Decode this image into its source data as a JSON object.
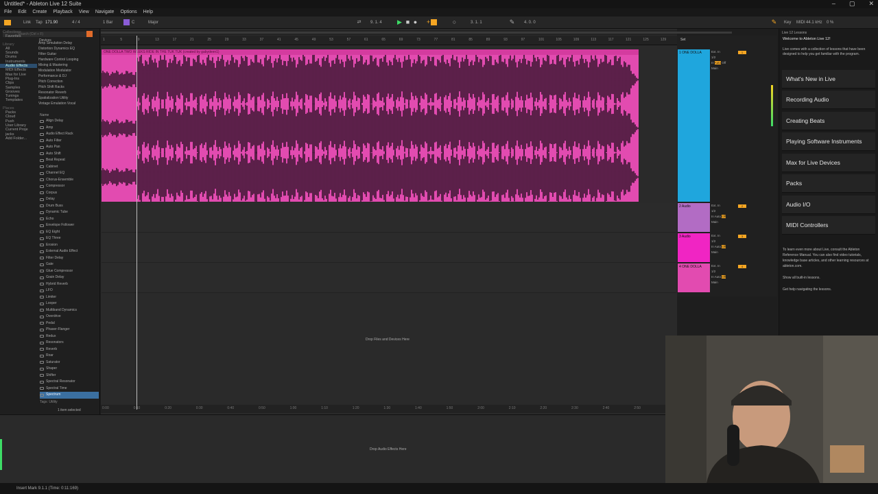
{
  "window": {
    "title": "Untitled* - Ableton Live 12 Suite",
    "controls": [
      "–",
      "▢",
      "✕"
    ]
  },
  "menu": [
    "File",
    "Edit",
    "Create",
    "Playback",
    "View",
    "Navigate",
    "Options",
    "Help"
  ],
  "transport": {
    "link": "Link",
    "tap": "Tap",
    "tempo": "171.90",
    "time_sig": "4 / 4",
    "quantize": "1 Bar",
    "key": "C",
    "scale": "Major",
    "position": "9. 1. 4",
    "loop_start": "3. 1. 1",
    "loop_length": "4. 0. 0",
    "key_label": "Key",
    "midi_label": "MIDI",
    "sample_rate": "44.1 kHz",
    "cpu": "0 %"
  },
  "browser": {
    "search_placeholder": "Search (Ctrl + F)",
    "places_header": "Collections",
    "favorites": "Favorites",
    "library_header": "Library",
    "library": [
      "All",
      "Sounds",
      "Drums",
      "Instruments",
      "Audio Effects",
      "MIDI Effects",
      "Max for Live",
      "Plug-Ins",
      "Clips",
      "Samples",
      "Grooves",
      "Tunings",
      "Templates"
    ],
    "places2_header": "Places",
    "places2": [
      "Packs",
      "Cloud",
      "Push",
      "User Library",
      "Current Proje",
      "jacks",
      "Add Folder..."
    ],
    "cat_header": "Devices",
    "categories": [
      "Amp Simulation   Delay",
      "Distortion   Dynamics   EQ",
      "Filter   Guitar",
      "Hardware Control   Looping",
      "Mixing & Mastering",
      "Modulation   Modulator",
      "Performance & DJ",
      "Pitch Correction",
      "Pitch Shift   Racks",
      "Resonator   Reverb",
      "Spatialization   Utility",
      "Vintage Emulation   Vocal"
    ],
    "name_header": "Name",
    "devices": [
      "Align Delay",
      "Amp",
      "Audio Effect Rack",
      "Auto Filter",
      "Auto Pan",
      "Auto Shift",
      "Beat Repeat",
      "Cabinet",
      "Channel EQ",
      "Chorus-Ensemble",
      "Compressor",
      "Corpus",
      "Delay",
      "Drum Buss",
      "Dynamic Tube",
      "Echo",
      "Envelope Follower",
      "EQ Eight",
      "EQ Three",
      "Erosion",
      "External Audio Effect",
      "Filter Delay",
      "Gate",
      "Glue Compressor",
      "Grain Delay",
      "Hybrid Reverb",
      "LFO",
      "Limiter",
      "Looper",
      "Multiband Dynamics",
      "Overdrive",
      "Pedal",
      "Phaser-Flanger",
      "Redux",
      "Resonators",
      "Reverb",
      "Roar",
      "Saturator",
      "Shaper",
      "Shifter",
      "Spectral Resonator",
      "Spectral Time",
      "Spectrum"
    ],
    "tags_label": "Tags:",
    "tag": "Utility",
    "selection": "1 item selected"
  },
  "arrangement": {
    "ruler": [
      "1",
      "5",
      "9",
      "13",
      "17",
      "21",
      "25",
      "29",
      "33",
      "37",
      "41",
      "45",
      "49",
      "53",
      "57",
      "61",
      "65",
      "69",
      "73",
      "77",
      "81",
      "85",
      "89",
      "93",
      "97",
      "101",
      "105",
      "109",
      "113",
      "117",
      "121",
      "125",
      "129"
    ],
    "clip_name": "ONE DOLLA TWO WEEKS RIDE IN THE TUK TUK (created by gabydeen1)",
    "drop_files": "Drop Files and Devices Here",
    "time_ticks": [
      "0:00",
      "0:10",
      "0:20",
      "0:30",
      "0:40",
      "0:50",
      "1:00",
      "1:10",
      "1:20",
      "1:30",
      "1:40",
      "1:50",
      "2:00",
      "2:10",
      "2:20",
      "2:30",
      "2:40",
      "2:50"
    ]
  },
  "tracks": [
    {
      "name": "1 ONE DOLLA",
      "color": "#1fa6dd",
      "num": "1"
    },
    {
      "name": "2 Audio",
      "color": "#b26cc4",
      "num": "2"
    },
    {
      "name": "3 Audio",
      "color": "#f025c3",
      "num": "3"
    },
    {
      "name": "4 ONE DOLLA",
      "color": "#e24bb0",
      "num": "4"
    }
  ],
  "track_ctl": {
    "input": "Ext. In",
    "ch": "1/2",
    "in": "In",
    "auto": "Auto",
    "off": "Off",
    "out": "Main",
    "set": "Set"
  },
  "lessons": {
    "header": "Live 12 Lessons",
    "welcome": "Welcome to Ableton Live 12!",
    "intro": "Live comes with a collection of lessons that have been designed to help you get familiar with the program.",
    "items": [
      "What's New in Live",
      "Recording Audio",
      "Creating Beats",
      "Playing Software Instruments",
      "Max for Live Devices",
      "Packs",
      "Audio I/O",
      "MIDI Controllers"
    ],
    "footer": "To learn even more about Live, consult the Ableton Reference Manual. You can also find video tutorials, knowledge base articles, and other learning resources at ableton.com.",
    "show_all": "Show all built-in lessons.",
    "help": "Get help navigating the lessons."
  },
  "detail": {
    "drop_effects": "Drop Audio Effects Here"
  },
  "status": {
    "text": "Insert Mark 9.1.1 (Time: 0:11:169)"
  },
  "colors": {
    "clip": "#e24bb0",
    "accent": "#f5a623",
    "selection": "#3b6fa0"
  }
}
